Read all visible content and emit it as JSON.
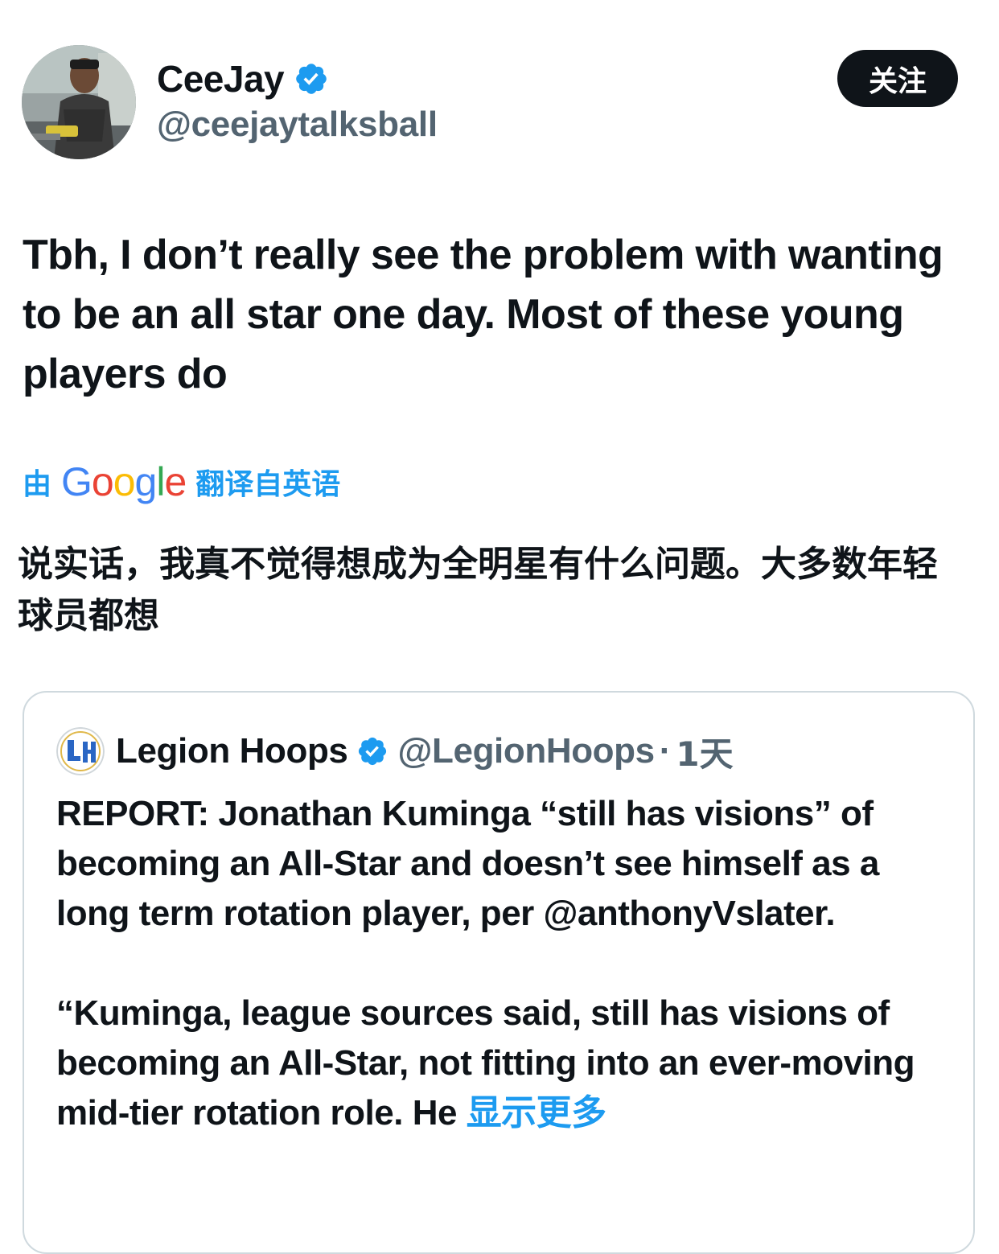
{
  "author": {
    "display_name": "CeeJay",
    "handle": "@ceejaytalksball",
    "verified": true,
    "avatar_icon": "user-avatar-photo"
  },
  "follow_button": {
    "label": "关注"
  },
  "tweet": {
    "text": "Tbh, I don’t really see the problem with wanting to be an all star one day. Most of these young players do"
  },
  "translation": {
    "prefix": "由",
    "provider_letters": [
      "G",
      "o",
      "o",
      "g",
      "l",
      "e"
    ],
    "suffix": "翻译自英语",
    "text": "说实话，我真不觉得想成为全明星有什么问题。大多数年轻球员都想"
  },
  "quoted_tweet": {
    "display_name": "Legion Hoops",
    "handle": "@LegionHoops",
    "separator": "·",
    "time": "1天",
    "verified": true,
    "avatar_icon": "legion-hoops-logo",
    "paragraphs": [
      "REPORT: Jonathan Kuminga “still has visions” of becoming an All-Star and doesn’t see himself as a long term rotation player, per @anthonyVslater.",
      "“Kuminga, league sources said, still has visions of becoming an All-Star, not fitting into an ever-moving mid-tier rotation role. He"
    ],
    "show_more_label": "显示更多"
  },
  "colors": {
    "link_blue": "#1d9bf0",
    "secondary_text": "#536471",
    "primary_text": "#0f1419",
    "border": "#cfd9de",
    "verified_badge": "#1d9bf0"
  }
}
